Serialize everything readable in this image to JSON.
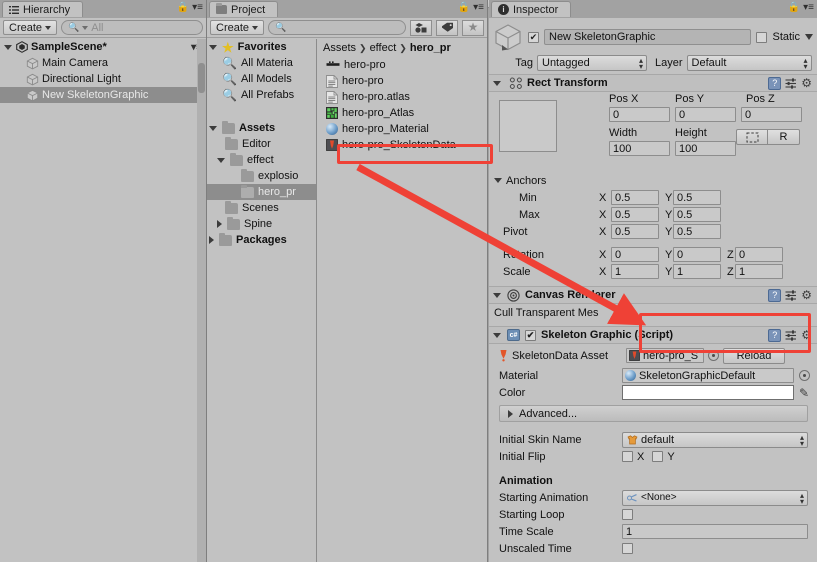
{
  "window": {
    "bg_color": "#c2c2c2",
    "accent_red": "#ef4136"
  },
  "hierarchy": {
    "tab_label": "Hierarchy",
    "tab_icon": "hierarchy-icon",
    "create_label": "Create",
    "search_placeholder": "All",
    "scene": {
      "name": "SampleScene*",
      "icon": "unity-scene-icon"
    },
    "items": [
      {
        "label": "Main Camera",
        "icon": "gameobject-cube-icon",
        "selected": false
      },
      {
        "label": "Directional Light",
        "icon": "gameobject-cube-icon",
        "selected": false
      },
      {
        "label": "New SkeletonGraphic",
        "icon": "gameobject-cube-icon",
        "selected": true
      }
    ]
  },
  "project": {
    "tab_label": "Project",
    "tab_icon": "folder-icon",
    "create_label": "Create",
    "search_placeholder": "",
    "tree": [
      {
        "label": "Favorites",
        "icon": "star-icon",
        "depth": 0,
        "arrow": "open",
        "bold": true
      },
      {
        "label": "All Materia",
        "icon": "search-icon",
        "depth": 1,
        "arrow": "none",
        "bold": false
      },
      {
        "label": "All Models",
        "icon": "search-icon",
        "depth": 1,
        "arrow": "none",
        "bold": false
      },
      {
        "label": "All Prefabs",
        "icon": "search-icon",
        "depth": 1,
        "arrow": "none",
        "bold": false
      },
      {
        "label": "",
        "icon": "none",
        "depth": 0,
        "arrow": "none",
        "bold": false
      },
      {
        "label": "Assets",
        "icon": "folder-icon",
        "depth": 0,
        "arrow": "open",
        "bold": true
      },
      {
        "label": "Editor",
        "icon": "folder-icon",
        "depth": 1,
        "arrow": "none",
        "bold": false
      },
      {
        "label": "effect",
        "icon": "folder-icon",
        "depth": 1,
        "arrow": "open",
        "bold": false
      },
      {
        "label": "explosio",
        "icon": "folder-icon",
        "depth": 2,
        "arrow": "none",
        "bold": false
      },
      {
        "label": "hero_pr",
        "icon": "folder-icon",
        "depth": 2,
        "arrow": "none",
        "bold": false,
        "selected": true
      },
      {
        "label": "Scenes",
        "icon": "folder-icon",
        "depth": 1,
        "arrow": "none",
        "bold": false
      },
      {
        "label": "Spine",
        "icon": "folder-icon",
        "depth": 1,
        "arrow": "closed",
        "bold": false
      },
      {
        "label": "Packages",
        "icon": "folder-icon",
        "depth": 0,
        "arrow": "closed",
        "bold": true
      }
    ],
    "breadcrumb": [
      "Assets",
      "effect",
      "hero_pr"
    ],
    "assets": [
      {
        "label": "hero-pro",
        "icon": "spine-skeleton-icon",
        "highlighted": false
      },
      {
        "label": "hero-pro",
        "icon": "text-asset-icon",
        "highlighted": false
      },
      {
        "label": "hero-pro.atlas",
        "icon": "text-asset-icon",
        "highlighted": false
      },
      {
        "label": "hero-pro_Atlas",
        "icon": "atlas-asset-icon",
        "highlighted": false
      },
      {
        "label": "hero-pro_Material",
        "icon": "material-sphere-icon",
        "highlighted": false
      },
      {
        "label": "hero-pro_SkeletonData",
        "icon": "skeletondata-icon",
        "highlighted": true
      }
    ]
  },
  "inspector": {
    "tab_label": "Inspector",
    "tab_icon": "info-icon",
    "object_name": "New SkeletonGraphic",
    "object_enabled": true,
    "static_label": "Static",
    "static_checked": false,
    "tag_label": "Tag",
    "tag_value": "Untagged",
    "layer_label": "Layer",
    "layer_value": "Default",
    "rect_transform": {
      "title": "Rect Transform",
      "pos_labels": [
        "Pos X",
        "Pos Y",
        "Pos Z"
      ],
      "pos_values": [
        "0",
        "0",
        "0"
      ],
      "size_labels": [
        "Width",
        "Height"
      ],
      "size_values": [
        "100",
        "100"
      ],
      "blueprint_btn": "blueprint-icon",
      "raw_btn": "R",
      "anchors_label": "Anchors",
      "min_label": "Min",
      "min_x": "0.5",
      "min_y": "0.5",
      "max_label": "Max",
      "max_x": "0.5",
      "max_y": "0.5",
      "pivot_label": "Pivot",
      "pivot_x": "0.5",
      "pivot_y": "0.5",
      "rotation_label": "Rotation",
      "rotation": [
        "0",
        "0",
        "0"
      ],
      "scale_label": "Scale",
      "scale": [
        "1",
        "1",
        "1"
      ],
      "axis_x": "X",
      "axis_y": "Y",
      "axis_z": "Z"
    },
    "canvas_renderer": {
      "title": "Canvas Renderer",
      "cull_label": "Cull Transparent Mes",
      "cull_checked": false
    },
    "skeleton_graphic": {
      "title": "Skeleton Graphic (Script)",
      "enabled": true,
      "skeletondata_label": "SkeletonData Asset",
      "skeletondata_value": "hero-pro_S",
      "reload_label": "Reload",
      "material_label": "Material",
      "material_value": "SkeletonGraphicDefault",
      "color_label": "Color",
      "color_value": "#ffffff",
      "advanced_label": "Advanced...",
      "initial_skin_label": "Initial Skin Name",
      "initial_skin_value": "default",
      "initial_flip_label": "Initial Flip",
      "flip_x_label": "X",
      "flip_x_checked": false,
      "flip_y_label": "Y",
      "flip_y_checked": false,
      "animation_section": "Animation",
      "starting_animation_label": "Starting Animation",
      "starting_animation_value": "<None>",
      "starting_loop_label": "Starting Loop",
      "starting_loop_checked": false,
      "time_scale_label": "Time Scale",
      "time_scale_value": "1",
      "unscaled_time_label": "Unscaled Time",
      "unscaled_time_checked": false
    }
  },
  "annotations": {
    "box_asset": "highlight-box-skeletondata-asset",
    "box_component": "highlight-box-skeleton-graphic-field",
    "arrow": "red-arrow-pointing-from-asset-to-component-field"
  }
}
